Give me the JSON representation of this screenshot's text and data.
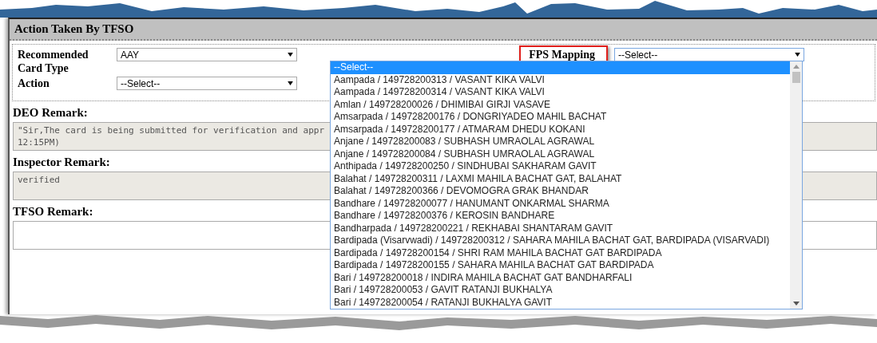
{
  "panel": {
    "title": "Action Taken By TFSO"
  },
  "fields": [
    {
      "label": "Recommended Card Type",
      "value": "AAY"
    },
    {
      "label": "Action",
      "value": "--Select--"
    }
  ],
  "fps_mapping": {
    "label": "FPS Mapping",
    "highlighted": true,
    "value": "--Select--",
    "expanded": true,
    "options": [
      {
        "label": "--Select--",
        "selected": true
      },
      {
        "label": "Aampada / 149728200313 / VASANT KIKA VALVI",
        "selected": false
      },
      {
        "label": "Aampada / 149728200314 / VASANT KIKA VALVI",
        "selected": false
      },
      {
        "label": "Amlan / 149728200026 / DHIMIBAI GIRJI VASAVE",
        "selected": false
      },
      {
        "label": "Amsarpada / 149728200176 / DONGRIYADEO MAHIL BACHAT",
        "selected": false
      },
      {
        "label": "Amsarpada / 149728200177 / ATMARAM DHEDU KOKANI",
        "selected": false
      },
      {
        "label": "Anjane / 149728200083 / SUBHASH UMRAOLAL AGRAWAL",
        "selected": false
      },
      {
        "label": "Anjane / 149728200084 / SUBHASH UMRAOLAL AGRAWAL",
        "selected": false
      },
      {
        "label": "Anthipada / 149728200250 / SINDHUBAI SAKHARAM GAVIT",
        "selected": false
      },
      {
        "label": "Balahat / 149728200311 / LAXMI MAHILA BACHAT GAT, BALAHAT",
        "selected": false
      },
      {
        "label": "Balahat / 149728200366 / DEVOMOGRA GRAK BHANDAR",
        "selected": false
      },
      {
        "label": "Bandhare / 149728200077 / HANUMANT ONKARMAL SHARMA",
        "selected": false
      },
      {
        "label": "Bandhare / 149728200376 / KEROSIN BANDHARE",
        "selected": false
      },
      {
        "label": "Bandharpada / 149728200221 / REKHABAI SHANTARAM GAVIT",
        "selected": false
      },
      {
        "label": "Bardipada (Visarvwadi) / 149728200312 / SAHARA MAHILA BACHAT GAT, BARDIPADA (VISARVADI)",
        "selected": false
      },
      {
        "label": "Bardipada / 149728200154 / SHRI RAM MAHILA BACHAT GAT BARDIPADA",
        "selected": false
      },
      {
        "label": "Bardipada / 149728200155 / SAHARA MAHILA BACHAT GAT BARDIPADA",
        "selected": false
      },
      {
        "label": "Bari / 149728200018 / INDIRA MAHILA BACHAT GAT BANDHARFALI",
        "selected": false
      },
      {
        "label": "Bari / 149728200053 / GAVIT RATANJI BUKHALYA",
        "selected": false
      },
      {
        "label": "Bari / 149728200054 / RATANJI BUKHALYA GAVIT",
        "selected": false
      }
    ]
  },
  "remarks": [
    {
      "label": "DEO Remark:",
      "kind": "readonly",
      "lines": [
        "\"Sir,The card is being submitted for verification and appr",
        "12:15PM)"
      ]
    },
    {
      "label": "Inspector Remark:",
      "kind": "readonly",
      "lines": [
        "verified"
      ]
    },
    {
      "label": "TFSO Remark:",
      "kind": "input"
    }
  ]
}
